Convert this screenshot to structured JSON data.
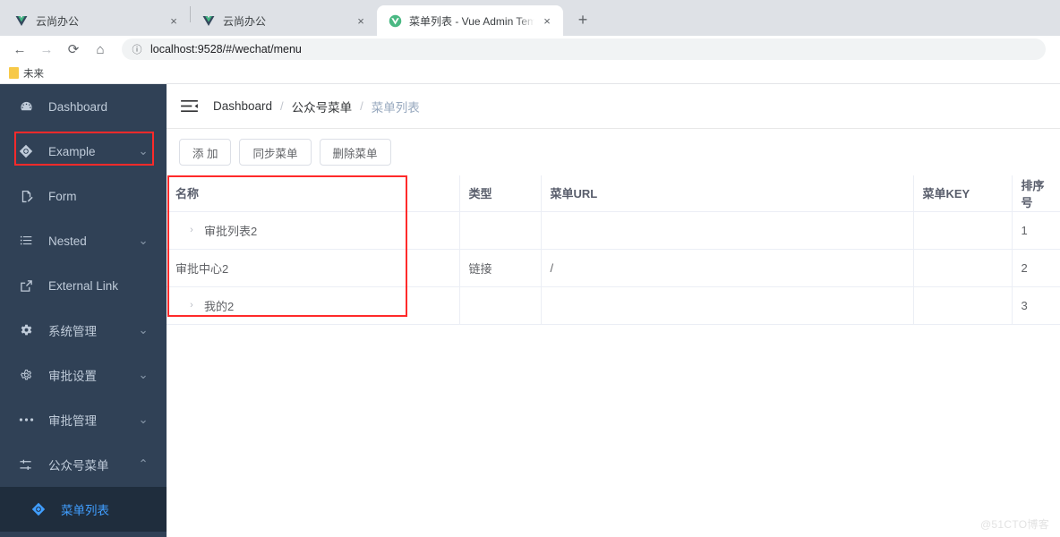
{
  "browser": {
    "tabs": [
      {
        "title": "云尚办公",
        "favicon": "vue-logo-icon",
        "active": false,
        "close_label": "×"
      },
      {
        "title": "云尚办公",
        "favicon": "vue-logo-icon",
        "active": false,
        "close_label": "×"
      },
      {
        "title": "菜单列表 - Vue Admin Template",
        "favicon": "vue-logo-green-icon",
        "active": true,
        "close_label": "×"
      }
    ],
    "new_tab_label": "+",
    "nav": {
      "back_label": "←",
      "forward_label": "→",
      "reload_label": "⟳",
      "home_label": "⌂"
    },
    "omnibox": {
      "site_info_icon": "info-circle-icon",
      "url": "localhost:9528/#/wechat/menu"
    },
    "bookmarks": [
      {
        "label": "未来",
        "icon": "folder-icon"
      }
    ]
  },
  "sidebar": {
    "items": [
      {
        "label": "Dashboard",
        "icon": "dashboard-icon",
        "arrow": "",
        "active": false
      },
      {
        "label": "Example",
        "icon": "component-icon",
        "arrow": "⌄",
        "active": false
      },
      {
        "label": "Form",
        "icon": "form-icon",
        "arrow": "",
        "active": false
      },
      {
        "label": "Nested",
        "icon": "nested-list-icon",
        "arrow": "⌄",
        "active": false
      },
      {
        "label": "External Link",
        "icon": "external-link-icon",
        "arrow": "",
        "active": false
      },
      {
        "label": "系统管理",
        "icon": "gear-icon",
        "arrow": "⌄",
        "active": false
      },
      {
        "label": "审批设置",
        "icon": "gear-outline-icon",
        "arrow": "⌄",
        "active": false
      },
      {
        "label": "审批管理",
        "icon": "dots-icon",
        "arrow": "⌄",
        "active": false
      },
      {
        "label": "公众号菜单",
        "icon": "sliders-icon",
        "arrow": "⌃",
        "active": false
      }
    ],
    "submenu": {
      "label": "菜单列表",
      "icon": "component-icon",
      "active": true
    }
  },
  "navbar": {
    "hamburger_icon": "hamburger-collapse-icon",
    "breadcrumb": [
      {
        "label": "Dashboard",
        "current": false
      },
      {
        "label": "公众号菜单",
        "current": false
      },
      {
        "label": "菜单列表",
        "current": true
      }
    ],
    "separator": "/"
  },
  "toolbar": {
    "buttons": [
      {
        "label": "添 加",
        "name": "add-button"
      },
      {
        "label": "同步菜单",
        "name": "sync-menu-button"
      },
      {
        "label": "删除菜单",
        "name": "delete-menu-button"
      }
    ]
  },
  "table": {
    "columns": [
      {
        "label": "名称",
        "key": "name"
      },
      {
        "label": "类型",
        "key": "type"
      },
      {
        "label": "菜单URL",
        "key": "url"
      },
      {
        "label": "菜单KEY",
        "key": "menukey"
      },
      {
        "label": "排序号",
        "key": "order"
      }
    ],
    "rows": [
      {
        "name": "审批列表2",
        "expandable": true,
        "expand_icon": "›",
        "type": "",
        "url": "",
        "menukey": "",
        "order": "1"
      },
      {
        "name": "审批中心2",
        "expandable": false,
        "expand_icon": "",
        "type": "链接",
        "url": "/",
        "menukey": "",
        "order": "2"
      },
      {
        "name": "我的2",
        "expandable": true,
        "expand_icon": "›",
        "type": "",
        "url": "",
        "menukey": "",
        "order": "3"
      }
    ]
  },
  "watermark": {
    "text": "@51CTO博客"
  },
  "colors": {
    "sidebar_bg": "#304156",
    "sidebar_active_bg": "#1f2d3d",
    "accent_blue": "#409eff",
    "highlight_red": "#ff2a2a",
    "text_muted": "#97a8be"
  }
}
